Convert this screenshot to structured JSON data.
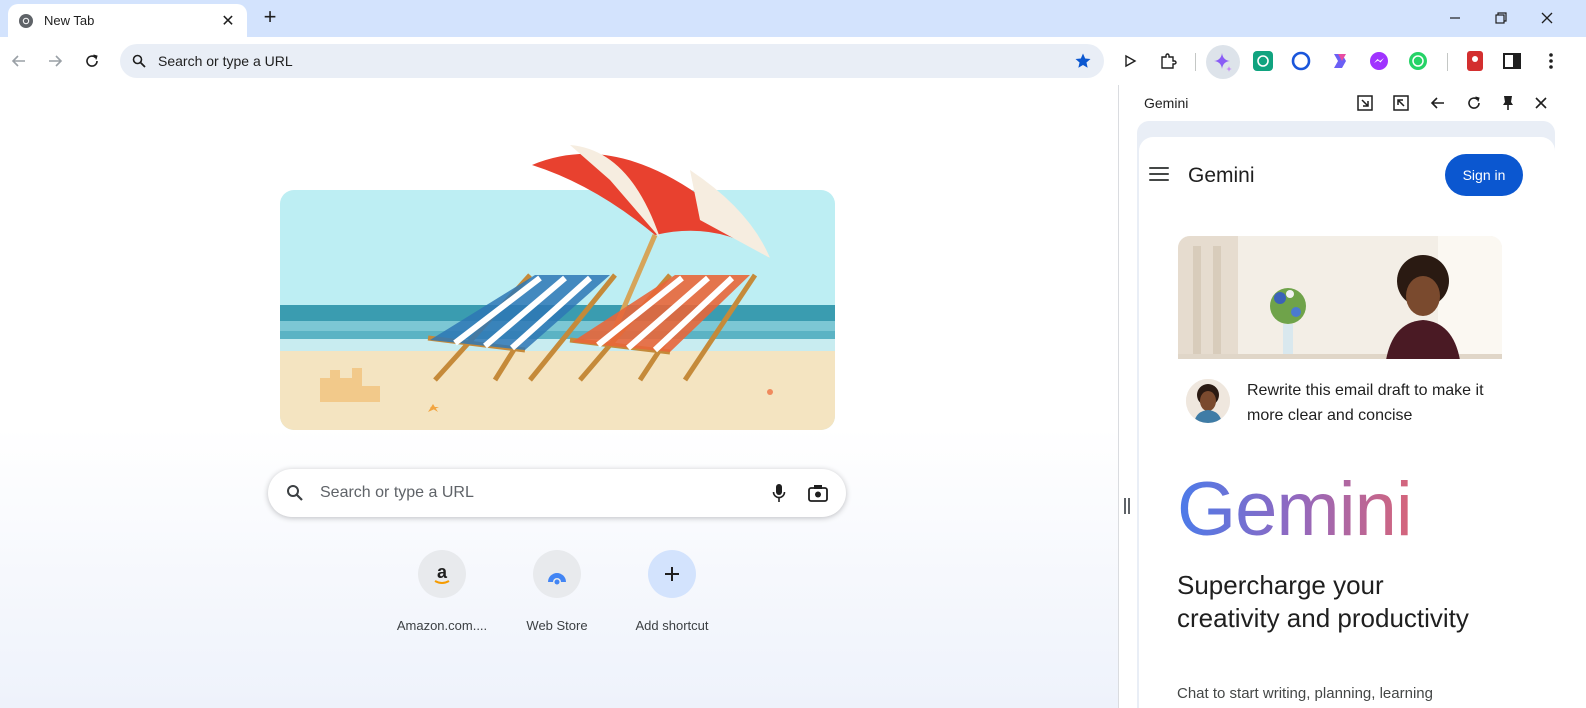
{
  "browser": {
    "tab": {
      "title": "New Tab"
    },
    "omnibox": {
      "placeholder": "Search or type a URL"
    }
  },
  "ntp": {
    "search": {
      "placeholder": "Search or type a URL"
    },
    "shortcuts": [
      {
        "label": "Amazon.com....",
        "icon": "amazon-icon"
      },
      {
        "label": "Web Store",
        "icon": "web-store-icon"
      },
      {
        "label": "Add shortcut",
        "icon": "plus-icon"
      }
    ]
  },
  "side_panel": {
    "title": "Gemini",
    "gemini": {
      "app_name": "Gemini",
      "sign_in": "Sign in",
      "prompt": "Rewrite this email draft to make it more clear and concise",
      "logo_text": "Gemini",
      "headline": "Supercharge your creativity and productivity",
      "subtext": "Chat to start writing, planning, learning"
    }
  },
  "colors": {
    "accent": "#0b57d0",
    "titlebar": "#d3e3fd",
    "omnibox": "#e9eef6",
    "bookmark_star": "#0b57d0"
  }
}
